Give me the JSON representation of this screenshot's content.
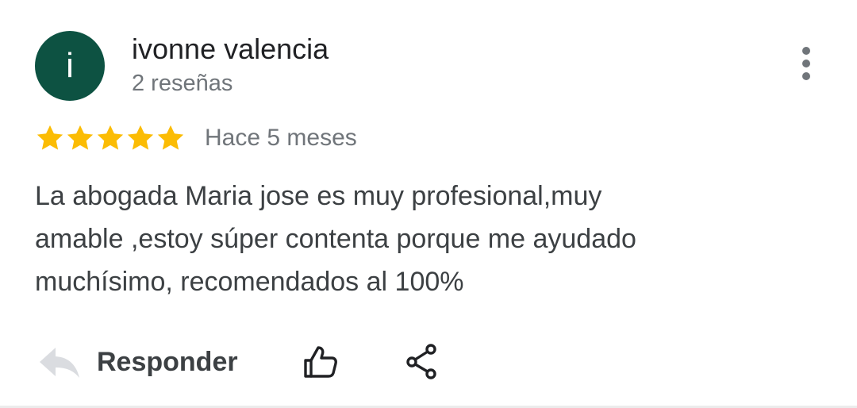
{
  "author": {
    "initial": "i",
    "name": "ivonne valencia",
    "review_count": "2 reseñas",
    "avatar_color": "#0d5242"
  },
  "rating": {
    "stars": 5,
    "max_stars": 5,
    "star_color": "#fbbc04",
    "time": "Hace 5 meses"
  },
  "review": {
    "lines": [
      "La abogada Maria jose es muy profesional,muy",
      "amable ,estoy súper contenta porque me ayudado",
      "muchísimo, recomendados al 100%"
    ]
  },
  "actions": {
    "reply_label": "Responder",
    "reply_icon": "reply-arrow-icon",
    "like_icon": "thumbs-up-icon",
    "share_icon": "share-icon"
  },
  "menu": {
    "icon": "more-vertical-icon"
  }
}
